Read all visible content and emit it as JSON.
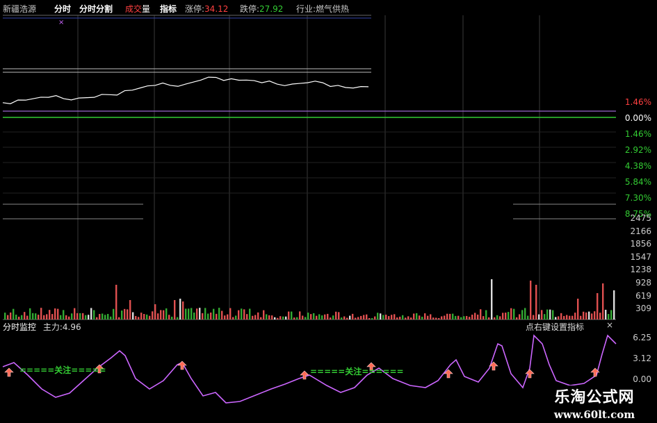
{
  "header": {
    "stock_name": "新疆浩源",
    "tab_fenshi": "分时",
    "tab_fenshi_split": "分时分割",
    "volume_tab_a": "成交",
    "volume_tab_b": "量",
    "tab_indicator": "指标",
    "limit_up_label": "涨停:",
    "limit_up_value": "34.12",
    "limit_down_label": "跌停:",
    "limit_down_value": "27.92",
    "industry_label": "行业:",
    "industry_value": "燃气供热"
  },
  "price_axis": [
    "1.46%",
    "0.00%",
    "1.46%",
    "2.92%",
    "4.38%",
    "5.84%",
    "7.30%",
    "8.75%"
  ],
  "volume_axis": [
    "2475",
    "2166",
    "1856",
    "1547",
    "1238",
    "928",
    "619",
    "309"
  ],
  "indicator_panel": {
    "name": "分时监控",
    "main_force_label": "主力:",
    "main_force_value": "4.96",
    "settings_link": "点右键设置指标",
    "close_glyph": "×",
    "axis": [
      "6.25",
      "3.12",
      "0.00"
    ],
    "attention_text_1": "=====关注=====",
    "attention_text_2": "=====关注======"
  },
  "watermark": {
    "line1": "乐淘公式网",
    "line2": "www.60lt.com"
  },
  "colors": {
    "red": "#ff4040",
    "green": "#33cc33",
    "white": "#ffffff",
    "grid": "#3a3a3a",
    "purple": "#cc66ff",
    "arrow": "#ff6a55"
  },
  "chart_data": [
    {
      "type": "line",
      "name": "intraday price",
      "x": [
        0,
        5,
        10,
        15,
        20,
        25,
        30,
        35,
        40,
        45,
        50,
        55,
        60,
        65,
        70,
        75,
        80,
        85,
        90,
        95,
        100,
        105,
        110,
        115,
        120
      ],
      "values": [
        -0.1,
        0.1,
        0.2,
        0.3,
        0.2,
        0.25,
        0.3,
        0.5,
        0.8,
        1.0,
        1.2,
        1.2,
        1.3,
        1.6,
        1.8,
        1.7,
        1.6,
        1.4,
        1.3,
        1.3,
        1.4,
        1.4,
        1.2,
        1.0,
        1.1
      ],
      "ylim": [
        -1.0,
        2.4
      ]
    },
    {
      "type": "bar",
      "name": "volume",
      "ylim": [
        0,
        2475
      ]
    },
    {
      "type": "line",
      "name": "分时监控",
      "ylim": [
        -2,
        7
      ]
    }
  ]
}
